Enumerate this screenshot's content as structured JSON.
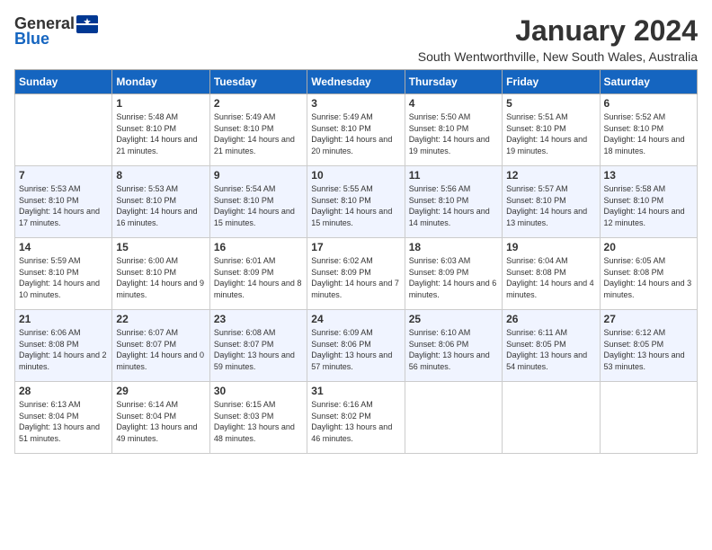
{
  "header": {
    "logo_general": "General",
    "logo_blue": "Blue",
    "month_title": "January 2024",
    "location": "South Wentworthville, New South Wales, Australia"
  },
  "weekdays": [
    "Sunday",
    "Monday",
    "Tuesday",
    "Wednesday",
    "Thursday",
    "Friday",
    "Saturday"
  ],
  "weeks": [
    [
      {
        "day": "",
        "sunrise": "",
        "sunset": "",
        "daylight": ""
      },
      {
        "day": "1",
        "sunrise": "Sunrise: 5:48 AM",
        "sunset": "Sunset: 8:10 PM",
        "daylight": "Daylight: 14 hours and 21 minutes."
      },
      {
        "day": "2",
        "sunrise": "Sunrise: 5:49 AM",
        "sunset": "Sunset: 8:10 PM",
        "daylight": "Daylight: 14 hours and 21 minutes."
      },
      {
        "day": "3",
        "sunrise": "Sunrise: 5:49 AM",
        "sunset": "Sunset: 8:10 PM",
        "daylight": "Daylight: 14 hours and 20 minutes."
      },
      {
        "day": "4",
        "sunrise": "Sunrise: 5:50 AM",
        "sunset": "Sunset: 8:10 PM",
        "daylight": "Daylight: 14 hours and 19 minutes."
      },
      {
        "day": "5",
        "sunrise": "Sunrise: 5:51 AM",
        "sunset": "Sunset: 8:10 PM",
        "daylight": "Daylight: 14 hours and 19 minutes."
      },
      {
        "day": "6",
        "sunrise": "Sunrise: 5:52 AM",
        "sunset": "Sunset: 8:10 PM",
        "daylight": "Daylight: 14 hours and 18 minutes."
      }
    ],
    [
      {
        "day": "7",
        "sunrise": "Sunrise: 5:53 AM",
        "sunset": "Sunset: 8:10 PM",
        "daylight": "Daylight: 14 hours and 17 minutes."
      },
      {
        "day": "8",
        "sunrise": "Sunrise: 5:53 AM",
        "sunset": "Sunset: 8:10 PM",
        "daylight": "Daylight: 14 hours and 16 minutes."
      },
      {
        "day": "9",
        "sunrise": "Sunrise: 5:54 AM",
        "sunset": "Sunset: 8:10 PM",
        "daylight": "Daylight: 14 hours and 15 minutes."
      },
      {
        "day": "10",
        "sunrise": "Sunrise: 5:55 AM",
        "sunset": "Sunset: 8:10 PM",
        "daylight": "Daylight: 14 hours and 15 minutes."
      },
      {
        "day": "11",
        "sunrise": "Sunrise: 5:56 AM",
        "sunset": "Sunset: 8:10 PM",
        "daylight": "Daylight: 14 hours and 14 minutes."
      },
      {
        "day": "12",
        "sunrise": "Sunrise: 5:57 AM",
        "sunset": "Sunset: 8:10 PM",
        "daylight": "Daylight: 14 hours and 13 minutes."
      },
      {
        "day": "13",
        "sunrise": "Sunrise: 5:58 AM",
        "sunset": "Sunset: 8:10 PM",
        "daylight": "Daylight: 14 hours and 12 minutes."
      }
    ],
    [
      {
        "day": "14",
        "sunrise": "Sunrise: 5:59 AM",
        "sunset": "Sunset: 8:10 PM",
        "daylight": "Daylight: 14 hours and 10 minutes."
      },
      {
        "day": "15",
        "sunrise": "Sunrise: 6:00 AM",
        "sunset": "Sunset: 8:10 PM",
        "daylight": "Daylight: 14 hours and 9 minutes."
      },
      {
        "day": "16",
        "sunrise": "Sunrise: 6:01 AM",
        "sunset": "Sunset: 8:09 PM",
        "daylight": "Daylight: 14 hours and 8 minutes."
      },
      {
        "day": "17",
        "sunrise": "Sunrise: 6:02 AM",
        "sunset": "Sunset: 8:09 PM",
        "daylight": "Daylight: 14 hours and 7 minutes."
      },
      {
        "day": "18",
        "sunrise": "Sunrise: 6:03 AM",
        "sunset": "Sunset: 8:09 PM",
        "daylight": "Daylight: 14 hours and 6 minutes."
      },
      {
        "day": "19",
        "sunrise": "Sunrise: 6:04 AM",
        "sunset": "Sunset: 8:08 PM",
        "daylight": "Daylight: 14 hours and 4 minutes."
      },
      {
        "day": "20",
        "sunrise": "Sunrise: 6:05 AM",
        "sunset": "Sunset: 8:08 PM",
        "daylight": "Daylight: 14 hours and 3 minutes."
      }
    ],
    [
      {
        "day": "21",
        "sunrise": "Sunrise: 6:06 AM",
        "sunset": "Sunset: 8:08 PM",
        "daylight": "Daylight: 14 hours and 2 minutes."
      },
      {
        "day": "22",
        "sunrise": "Sunrise: 6:07 AM",
        "sunset": "Sunset: 8:07 PM",
        "daylight": "Daylight: 14 hours and 0 minutes."
      },
      {
        "day": "23",
        "sunrise": "Sunrise: 6:08 AM",
        "sunset": "Sunset: 8:07 PM",
        "daylight": "Daylight: 13 hours and 59 minutes."
      },
      {
        "day": "24",
        "sunrise": "Sunrise: 6:09 AM",
        "sunset": "Sunset: 8:06 PM",
        "daylight": "Daylight: 13 hours and 57 minutes."
      },
      {
        "day": "25",
        "sunrise": "Sunrise: 6:10 AM",
        "sunset": "Sunset: 8:06 PM",
        "daylight": "Daylight: 13 hours and 56 minutes."
      },
      {
        "day": "26",
        "sunrise": "Sunrise: 6:11 AM",
        "sunset": "Sunset: 8:05 PM",
        "daylight": "Daylight: 13 hours and 54 minutes."
      },
      {
        "day": "27",
        "sunrise": "Sunrise: 6:12 AM",
        "sunset": "Sunset: 8:05 PM",
        "daylight": "Daylight: 13 hours and 53 minutes."
      }
    ],
    [
      {
        "day": "28",
        "sunrise": "Sunrise: 6:13 AM",
        "sunset": "Sunset: 8:04 PM",
        "daylight": "Daylight: 13 hours and 51 minutes."
      },
      {
        "day": "29",
        "sunrise": "Sunrise: 6:14 AM",
        "sunset": "Sunset: 8:04 PM",
        "daylight": "Daylight: 13 hours and 49 minutes."
      },
      {
        "day": "30",
        "sunrise": "Sunrise: 6:15 AM",
        "sunset": "Sunset: 8:03 PM",
        "daylight": "Daylight: 13 hours and 48 minutes."
      },
      {
        "day": "31",
        "sunrise": "Sunrise: 6:16 AM",
        "sunset": "Sunset: 8:02 PM",
        "daylight": "Daylight: 13 hours and 46 minutes."
      },
      {
        "day": "",
        "sunrise": "",
        "sunset": "",
        "daylight": ""
      },
      {
        "day": "",
        "sunrise": "",
        "sunset": "",
        "daylight": ""
      },
      {
        "day": "",
        "sunrise": "",
        "sunset": "",
        "daylight": ""
      }
    ]
  ]
}
